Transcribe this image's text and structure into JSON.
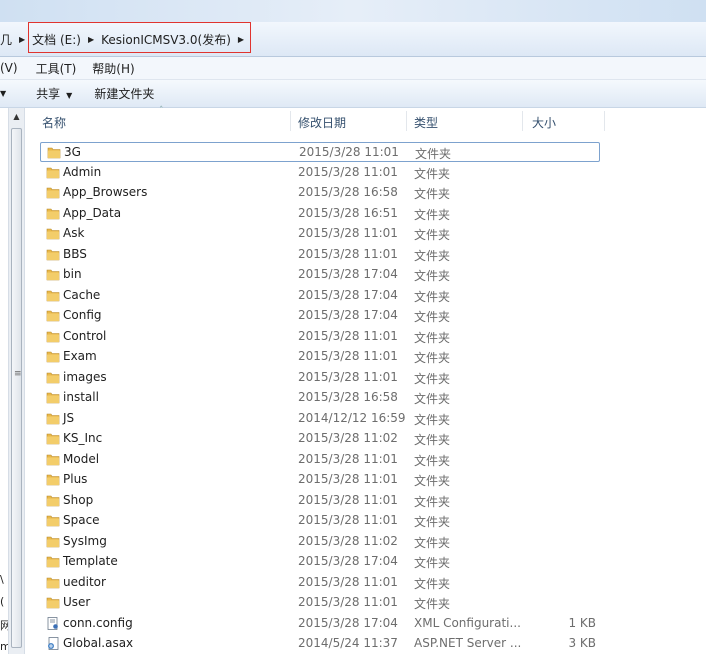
{
  "address": {
    "crumbs": [
      "几",
      "文档 (E:)",
      "KesionICMSV3.0(发布)"
    ]
  },
  "menu": {
    "items": [
      "(V)",
      "工具(T)",
      "帮助(H)"
    ]
  },
  "commands": {
    "share_label": "共享",
    "new_folder_label": "新建文件夹"
  },
  "left_fragments": [
    "\\",
    "(",
    "网",
    "m"
  ],
  "columns": {
    "name": "名称",
    "date": "修改日期",
    "type": "类型",
    "size": "大小"
  },
  "files": [
    {
      "name": "3G",
      "date": "2015/3/28 11:01",
      "type": "文件夹",
      "size": "",
      "icon": "folder-icon"
    },
    {
      "name": "Admin",
      "date": "2015/3/28 11:01",
      "type": "文件夹",
      "size": "",
      "icon": "folder-icon"
    },
    {
      "name": "App_Browsers",
      "date": "2015/3/28 16:58",
      "type": "文件夹",
      "size": "",
      "icon": "folder-icon"
    },
    {
      "name": "App_Data",
      "date": "2015/3/28 16:51",
      "type": "文件夹",
      "size": "",
      "icon": "folder-icon"
    },
    {
      "name": "Ask",
      "date": "2015/3/28 11:01",
      "type": "文件夹",
      "size": "",
      "icon": "folder-icon"
    },
    {
      "name": "BBS",
      "date": "2015/3/28 11:01",
      "type": "文件夹",
      "size": "",
      "icon": "folder-icon"
    },
    {
      "name": "bin",
      "date": "2015/3/28 17:04",
      "type": "文件夹",
      "size": "",
      "icon": "folder-icon"
    },
    {
      "name": "Cache",
      "date": "2015/3/28 17:04",
      "type": "文件夹",
      "size": "",
      "icon": "folder-icon"
    },
    {
      "name": "Config",
      "date": "2015/3/28 17:04",
      "type": "文件夹",
      "size": "",
      "icon": "folder-icon"
    },
    {
      "name": "Control",
      "date": "2015/3/28 11:01",
      "type": "文件夹",
      "size": "",
      "icon": "folder-icon"
    },
    {
      "name": "Exam",
      "date": "2015/3/28 11:01",
      "type": "文件夹",
      "size": "",
      "icon": "folder-icon"
    },
    {
      "name": "images",
      "date": "2015/3/28 11:01",
      "type": "文件夹",
      "size": "",
      "icon": "folder-icon"
    },
    {
      "name": "install",
      "date": "2015/3/28 16:58",
      "type": "文件夹",
      "size": "",
      "icon": "folder-icon"
    },
    {
      "name": "JS",
      "date": "2014/12/12 16:59",
      "type": "文件夹",
      "size": "",
      "icon": "folder-icon"
    },
    {
      "name": "KS_Inc",
      "date": "2015/3/28 11:02",
      "type": "文件夹",
      "size": "",
      "icon": "folder-icon"
    },
    {
      "name": "Model",
      "date": "2015/3/28 11:01",
      "type": "文件夹",
      "size": "",
      "icon": "folder-icon"
    },
    {
      "name": "Plus",
      "date": "2015/3/28 11:01",
      "type": "文件夹",
      "size": "",
      "icon": "folder-icon"
    },
    {
      "name": "Shop",
      "date": "2015/3/28 11:01",
      "type": "文件夹",
      "size": "",
      "icon": "folder-icon"
    },
    {
      "name": "Space",
      "date": "2015/3/28 11:01",
      "type": "文件夹",
      "size": "",
      "icon": "folder-icon"
    },
    {
      "name": "SysImg",
      "date": "2015/3/28 11:02",
      "type": "文件夹",
      "size": "",
      "icon": "folder-icon"
    },
    {
      "name": "Template",
      "date": "2015/3/28 17:04",
      "type": "文件夹",
      "size": "",
      "icon": "folder-icon"
    },
    {
      "name": "ueditor",
      "date": "2015/3/28 11:01",
      "type": "文件夹",
      "size": "",
      "icon": "folder-icon"
    },
    {
      "name": "User",
      "date": "2015/3/28 11:01",
      "type": "文件夹",
      "size": "",
      "icon": "folder-icon"
    },
    {
      "name": "conn.config",
      "date": "2015/3/28 17:04",
      "type": "XML Configurati...",
      "size": "1 KB",
      "icon": "config-file-icon"
    },
    {
      "name": "Global.asax",
      "date": "2014/5/24 11:37",
      "type": "ASP.NET Server ...",
      "size": "3 KB",
      "icon": "asax-file-icon"
    }
  ],
  "selected_index": 0,
  "colors": {
    "folder": "#e8b84a",
    "selection_border": "#7da2ce",
    "highlight_box": "#e0342f"
  }
}
